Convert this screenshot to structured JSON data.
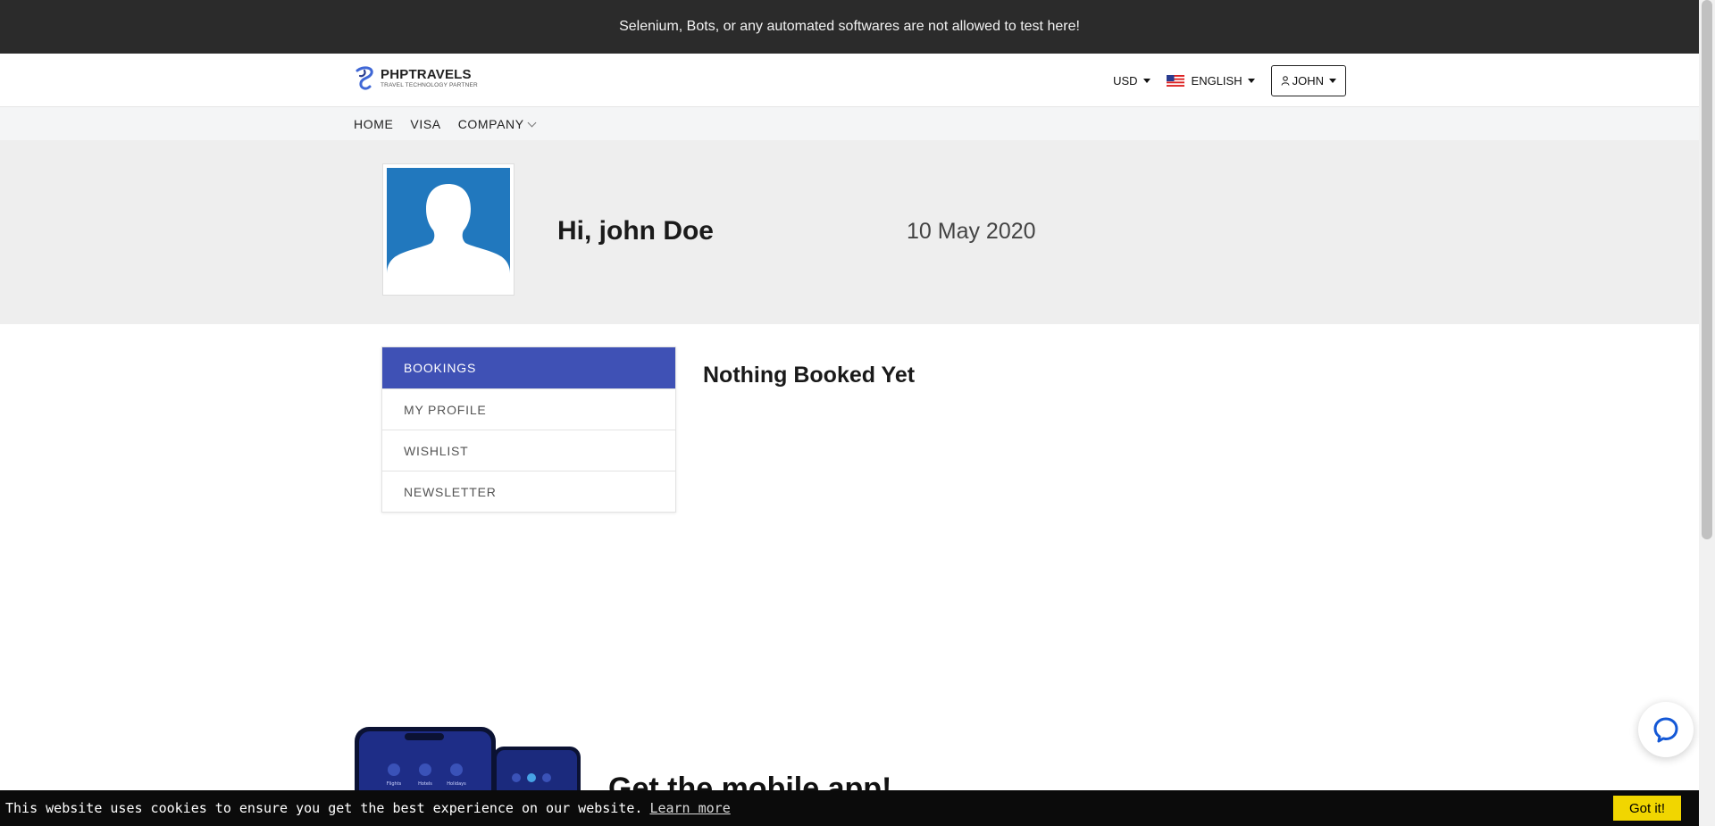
{
  "top_bar": {
    "message": "Selenium, Bots, or any automated softwares are not allowed to test here!"
  },
  "header": {
    "logo_name": "PHPTRAVELS",
    "logo_tagline": "TRAVEL TECHNOLOGY PARTNER",
    "currency": "USD",
    "language": "ENGLISH",
    "user": "JOHN"
  },
  "nav": {
    "items": [
      "HOME",
      "VISA",
      "COMPANY"
    ]
  },
  "profile": {
    "greeting": "Hi, john Doe",
    "date": "10 May 2020"
  },
  "menu": {
    "items": [
      "BOOKINGS",
      "MY PROFILE",
      "WISHLIST",
      "NEWSLETTER"
    ],
    "active": "BOOKINGS"
  },
  "content": {
    "title": "Nothing Booked Yet"
  },
  "app_section": {
    "title": "Get the mobile app!",
    "phone_labels": [
      "Flights",
      "Hotels",
      "Holidays"
    ]
  },
  "cookie": {
    "message": "This website uses cookies to ensure you get the best experience on our website.",
    "link": "Learn more",
    "button": "Got it!"
  },
  "colors": {
    "top_bar_bg": "#2b2b2b",
    "menu_active_bg": "#3f51b5",
    "avatar_bg": "#2178be",
    "cookie_button_bg": "#f1d600"
  }
}
